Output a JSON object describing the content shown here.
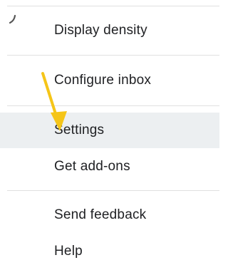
{
  "menu": {
    "items": [
      {
        "label": "Display density"
      },
      {
        "label": "Configure inbox"
      },
      {
        "label": "Settings",
        "highlighted": true
      },
      {
        "label": "Get add-ons"
      },
      {
        "label": "Send feedback"
      },
      {
        "label": "Help"
      }
    ]
  },
  "annotation": {
    "arrow_color": "#f5c518",
    "arrow_target": "Settings"
  },
  "colors": {
    "highlight_background": "#eceff1",
    "divider": "#e0e0e0",
    "text": "#202124"
  }
}
